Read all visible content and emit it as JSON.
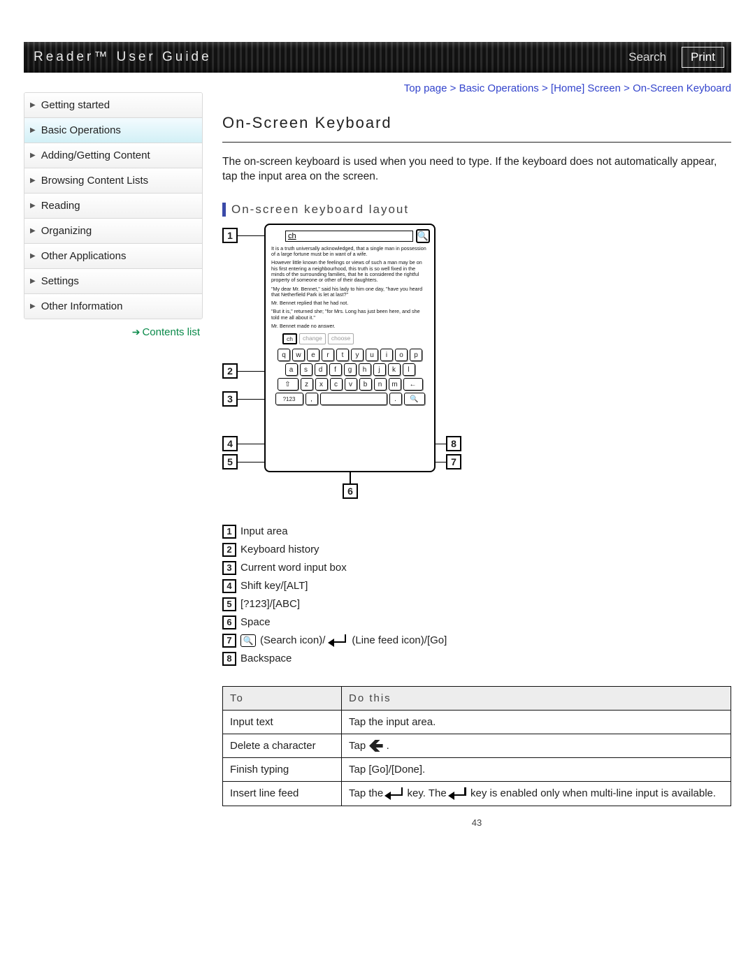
{
  "header": {
    "brand": "Reader™ User Guide",
    "search_label": "Search",
    "print_label": "Print"
  },
  "breadcrumb": {
    "items": [
      "Top page",
      "Basic Operations",
      "[Home] Screen",
      "On-Screen Keyboard"
    ],
    "sep": " > "
  },
  "sidebar": {
    "items": [
      {
        "label": "Getting started"
      },
      {
        "label": "Basic Operations",
        "active": true
      },
      {
        "label": "Adding/Getting Content"
      },
      {
        "label": "Browsing Content Lists"
      },
      {
        "label": "Reading"
      },
      {
        "label": "Organizing"
      },
      {
        "label": "Other Applications"
      },
      {
        "label": "Settings"
      },
      {
        "label": "Other Information"
      }
    ],
    "contents_link": "Contents list"
  },
  "page": {
    "title": "On-Screen Keyboard",
    "intro": "The on-screen keyboard is used when you need to type. If the keyboard does not automatically appear, tap the input area on the screen.",
    "sub": "On-screen keyboard layout",
    "page_number": "43"
  },
  "diagram": {
    "input_value": "ch",
    "para1": "It is a truth universally acknowledged, that a single man in possession of a large fortune must be in want of a wife.",
    "para2": "However little known the feelings or views of such a man may be on his first entering a neighbourhood, this truth is so well fixed in the minds of the surrounding families, that he is considered the rightful property of someone or other of their daughters.",
    "para3": "\"My dear Mr. Bennet,\" said his lady to him one day, \"have you heard that Netherfield Park is let at last?\"",
    "para4": "Mr. Bennet replied that he had not.",
    "para5": "\"But it is,\" returned she; \"for Mrs. Long has just been here, and she told me all about it.\"",
    "para6": "Mr. Bennet made no answer.",
    "suggestions": [
      "ch",
      "change",
      "choose"
    ],
    "row1": [
      "q",
      "w",
      "e",
      "r",
      "t",
      "y",
      "u",
      "i",
      "o",
      "p"
    ],
    "row2": [
      "a",
      "s",
      "d",
      "f",
      "g",
      "h",
      "j",
      "k",
      "l"
    ],
    "row3_letters": [
      "z",
      "x",
      "c",
      "v",
      "b",
      "n",
      "m"
    ],
    "shift": "⇧",
    "bks": "←",
    "mode": "?123",
    "comma": ",",
    "period": ".",
    "search": "🔍",
    "callouts": [
      "1",
      "2",
      "3",
      "4",
      "5",
      "6",
      "7",
      "8"
    ]
  },
  "legend": {
    "items": [
      {
        "n": "1",
        "text": "Input area"
      },
      {
        "n": "2",
        "text": "Keyboard history"
      },
      {
        "n": "3",
        "text": "Current word input box"
      },
      {
        "n": "4",
        "text": "Shift key/[ALT]"
      },
      {
        "n": "5",
        "text": "[?123]/[ABC]"
      },
      {
        "n": "6",
        "text": "Space"
      },
      {
        "n": "7",
        "pre": "",
        "mid1": " (Search icon)/",
        "mid2": " (Line feed icon)/[Go]"
      },
      {
        "n": "8",
        "text": "Backspace"
      }
    ]
  },
  "table": {
    "head": [
      "To",
      "Do this"
    ],
    "rows": {
      "r1": {
        "to": "Input text",
        "do": "Tap the input area."
      },
      "r2": {
        "to": "Delete a character",
        "do_pre": "Tap ",
        "do_post": " ."
      },
      "r3": {
        "to": "Finish typing",
        "do": "Tap [Go]/[Done]."
      },
      "r4": {
        "to": "Insert line feed",
        "p1": "Tap the ",
        "p2": " key. The ",
        "p3": " key is enabled only when multi-line input is available."
      }
    }
  }
}
